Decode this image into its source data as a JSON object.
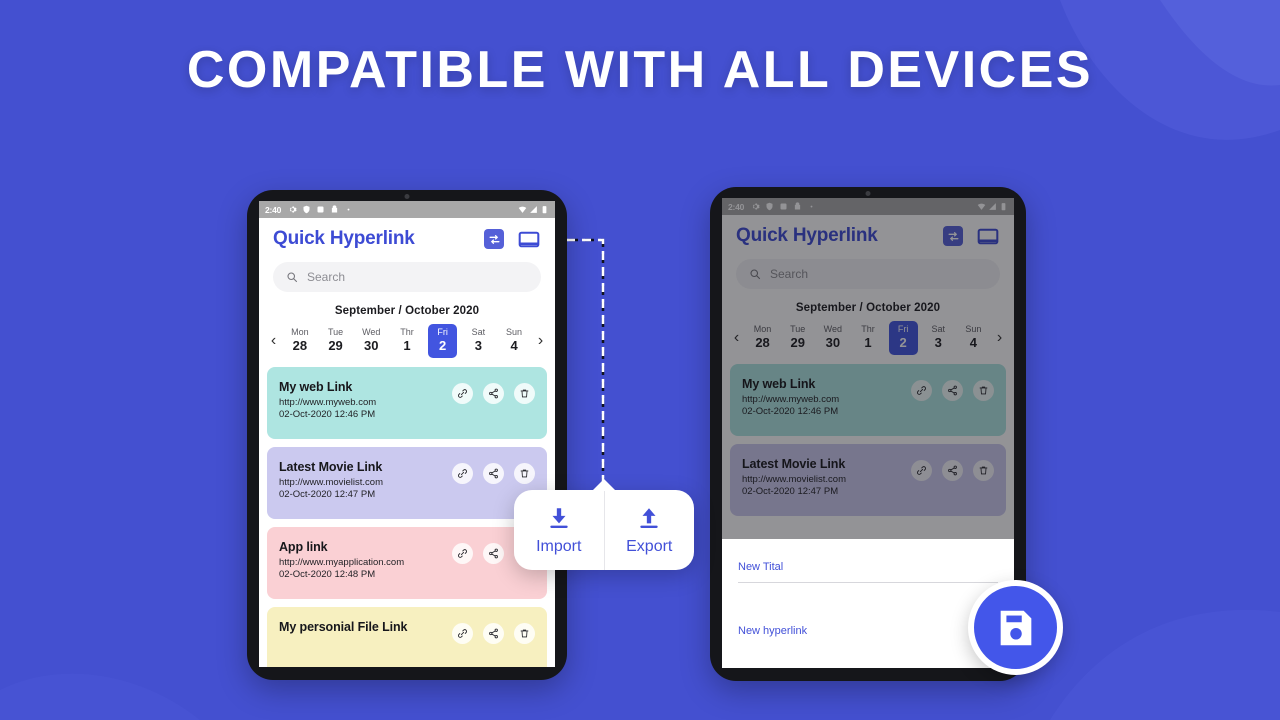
{
  "headline": "COMPATIBLE WITH ALL DEVICES",
  "colors": {
    "background": "#4450d0",
    "accent": "#4255e0",
    "brand_text": "#3d4bd4",
    "statusbar": "#a8a8a8"
  },
  "phone_left": {
    "statusbar": {
      "time": "2:40",
      "left_icons": [
        "gear-icon",
        "shield-icon",
        "square-icon",
        "bag-icon",
        "dot-icon"
      ],
      "right_icons": [
        "wifi-icon",
        "signal-icon",
        "battery-icon"
      ]
    },
    "appbar": {
      "title": "Quick Hyperlink",
      "actions": [
        "swap-icon",
        "card-view-icon"
      ]
    },
    "search": {
      "placeholder": "Search",
      "icon": "search-icon"
    },
    "calendar": {
      "month_label": "September  / October 2020",
      "prev_icon": "chevron-left-icon",
      "next_icon": "chevron-right-icon",
      "days": [
        {
          "name": "Mon",
          "num": "28",
          "selected": false
        },
        {
          "name": "Tue",
          "num": "29",
          "selected": false
        },
        {
          "name": "Wed",
          "num": "30",
          "selected": false
        },
        {
          "name": "Thr",
          "num": "1",
          "selected": false
        },
        {
          "name": "Fri",
          "num": "2",
          "selected": true
        },
        {
          "name": "Sat",
          "num": "3",
          "selected": false
        },
        {
          "name": "Sun",
          "num": "4",
          "selected": false
        }
      ]
    },
    "links": [
      {
        "title": "My web Link",
        "url": "http://www.myweb.com",
        "date": "02-Oct-2020 12:46 PM",
        "color": "#aee5e1",
        "actions": [
          "link-icon",
          "share-icon",
          "trash-icon"
        ]
      },
      {
        "title": "Latest Movie Link",
        "url": "http://www.movielist.com",
        "date": "02-Oct-2020 12:47 PM",
        "color": "#cbc9ef",
        "actions": [
          "link-icon",
          "share-icon",
          "trash-icon"
        ]
      },
      {
        "title": "App link",
        "url": "http://www.myapplication.com",
        "date": "02-Oct-2020 12:48 PM",
        "color": "#fad0d4",
        "actions": [
          "link-icon",
          "share-icon",
          "trash-icon"
        ]
      },
      {
        "title": "My personial File Link",
        "url": "",
        "date": "",
        "color": "#f7f0c0",
        "actions": [
          "link-icon",
          "share-icon",
          "trash-icon"
        ]
      }
    ]
  },
  "phone_right": {
    "statusbar": {
      "time": "2:40",
      "left_icons": [
        "gear-icon",
        "shield-icon",
        "square-icon",
        "bag-icon",
        "dot-icon"
      ],
      "right_icons": [
        "wifi-icon",
        "signal-icon",
        "battery-icon"
      ]
    },
    "appbar": {
      "title": "Quick Hyperlink",
      "actions": [
        "swap-icon",
        "card-view-icon"
      ]
    },
    "search": {
      "placeholder": "Search",
      "icon": "search-icon"
    },
    "calendar": {
      "month_label": "September  / October 2020",
      "prev_icon": "chevron-left-icon",
      "next_icon": "chevron-right-icon",
      "days": [
        {
          "name": "Mon",
          "num": "28",
          "selected": false
        },
        {
          "name": "Tue",
          "num": "29",
          "selected": false
        },
        {
          "name": "Wed",
          "num": "30",
          "selected": false
        },
        {
          "name": "Thr",
          "num": "1",
          "selected": false
        },
        {
          "name": "Fri",
          "num": "2",
          "selected": true
        },
        {
          "name": "Sat",
          "num": "3",
          "selected": false
        },
        {
          "name": "Sun",
          "num": "4",
          "selected": false
        }
      ]
    },
    "links": [
      {
        "title": "My web Link",
        "url": "http://www.myweb.com",
        "date": "02-Oct-2020 12:46 PM",
        "color": "#aee5e1",
        "actions": [
          "link-icon",
          "share-icon",
          "trash-icon"
        ]
      },
      {
        "title": "Latest Movie Link",
        "url": "http://www.movielist.com",
        "date": "02-Oct-2020 12:47 PM",
        "color": "#cbc9ef",
        "actions": [
          "link-icon",
          "share-icon",
          "trash-icon"
        ]
      }
    ],
    "dialog": {
      "title_field_placeholder": "New Tital",
      "hyperlink_field_placeholder": "New hyperlink"
    },
    "fab": {
      "icon": "save-icon"
    }
  },
  "popup": {
    "import": {
      "label": "Import",
      "icon": "download-icon"
    },
    "export": {
      "label": "Export",
      "icon": "upload-icon"
    }
  }
}
